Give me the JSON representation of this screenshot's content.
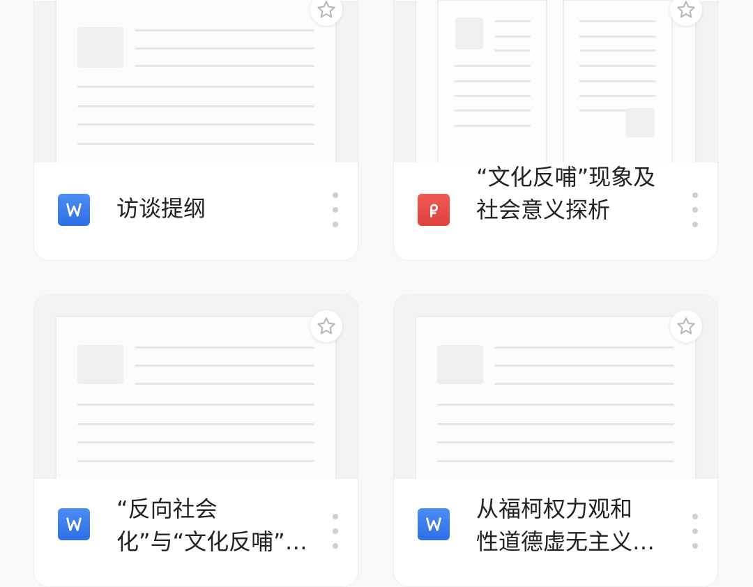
{
  "files": [
    {
      "title": "访谈提纲",
      "type": "word",
      "icon": "word-icon"
    },
    {
      "title": "“文化反哺”现象及\n社会意义探析",
      "type": "pdf",
      "icon": "pdf-icon"
    },
    {
      "title": "“反向社会\n化”与“文化反哺”…",
      "type": "word",
      "icon": "word-icon"
    },
    {
      "title": "从福柯权力观和\n性道德虚无主义…",
      "type": "word",
      "icon": "word-icon"
    }
  ],
  "colors": {
    "word": "#2f6fe6",
    "pdf": "#e0413c",
    "background": "#f8f8f9"
  }
}
